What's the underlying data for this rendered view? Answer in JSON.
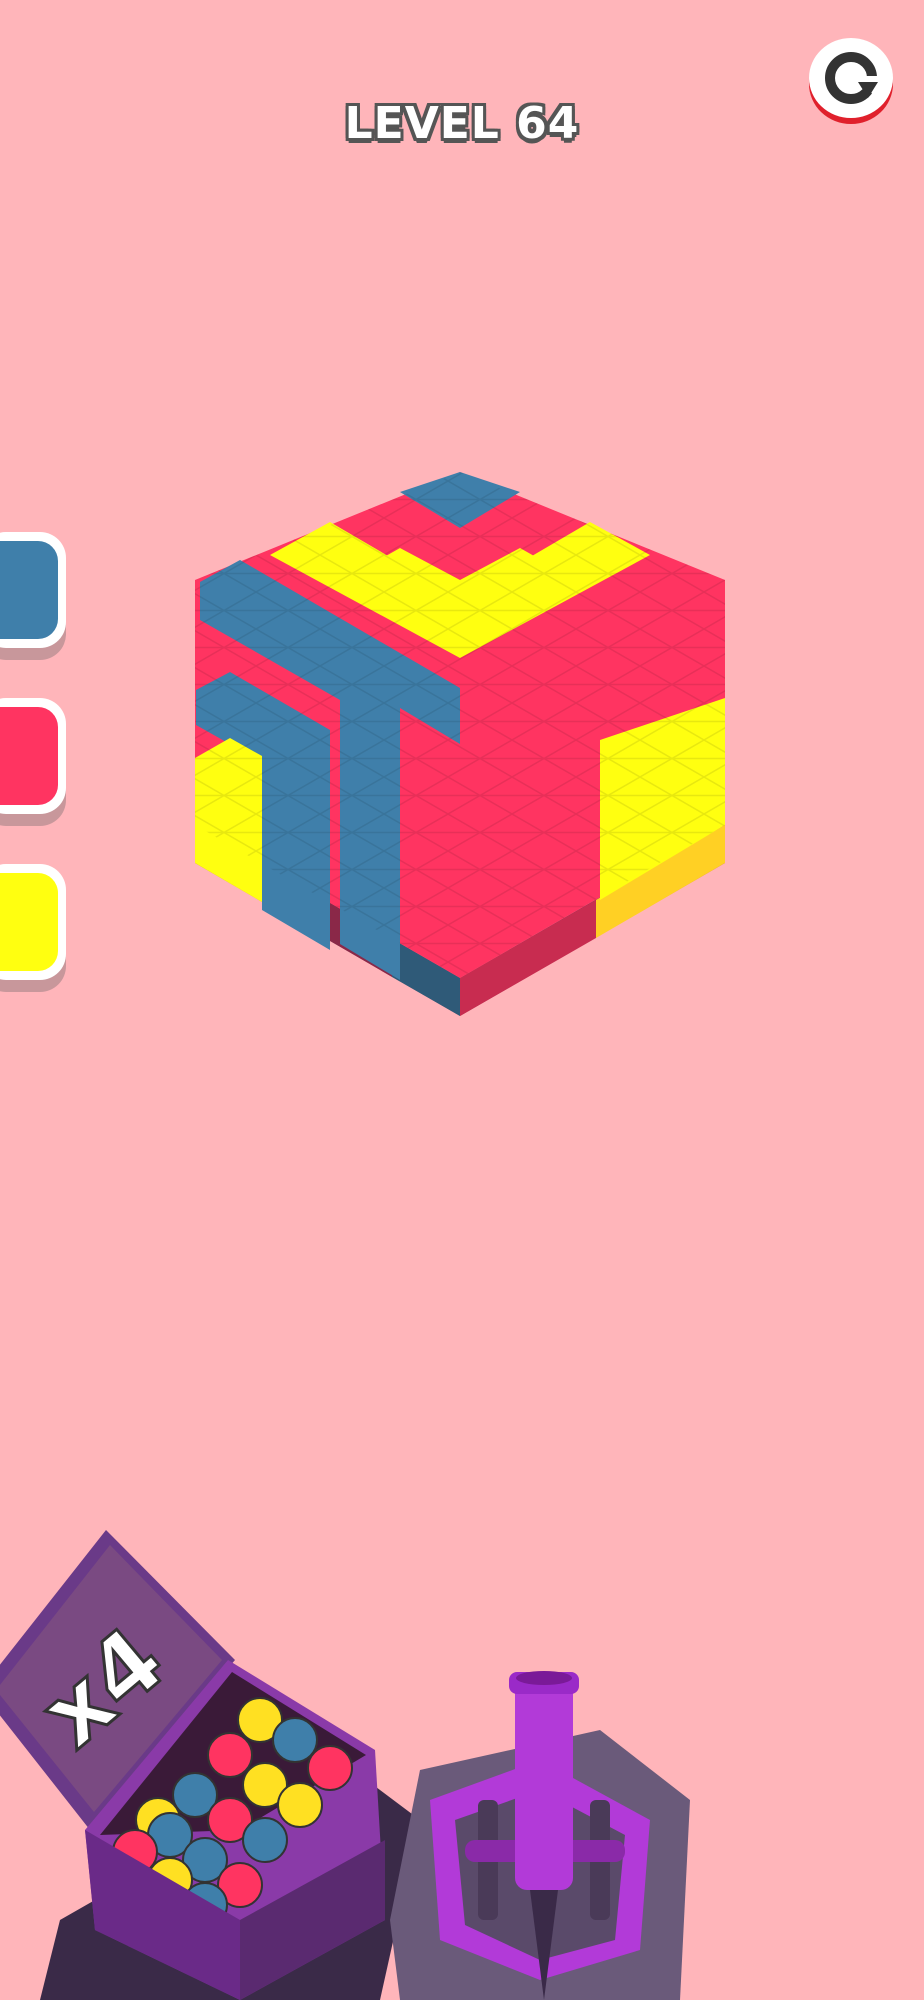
{
  "header": {
    "level_label": "LEVEL 64"
  },
  "buttons": {
    "restart_icon": "restart-icon"
  },
  "palette": {
    "swatches": [
      {
        "name": "blue",
        "color": "#3f7faa"
      },
      {
        "name": "red",
        "color": "#ff3461"
      },
      {
        "name": "yellow",
        "color": "#ffff10"
      }
    ]
  },
  "colors": {
    "background": "#ffb5ba",
    "blue": "#3f7faa",
    "red": "#ff3461",
    "yellow": "#ffff10",
    "cannon": "#b23ad8",
    "crate": "#8a3aa8"
  },
  "ball_box": {
    "multiplier_label": "x4"
  }
}
